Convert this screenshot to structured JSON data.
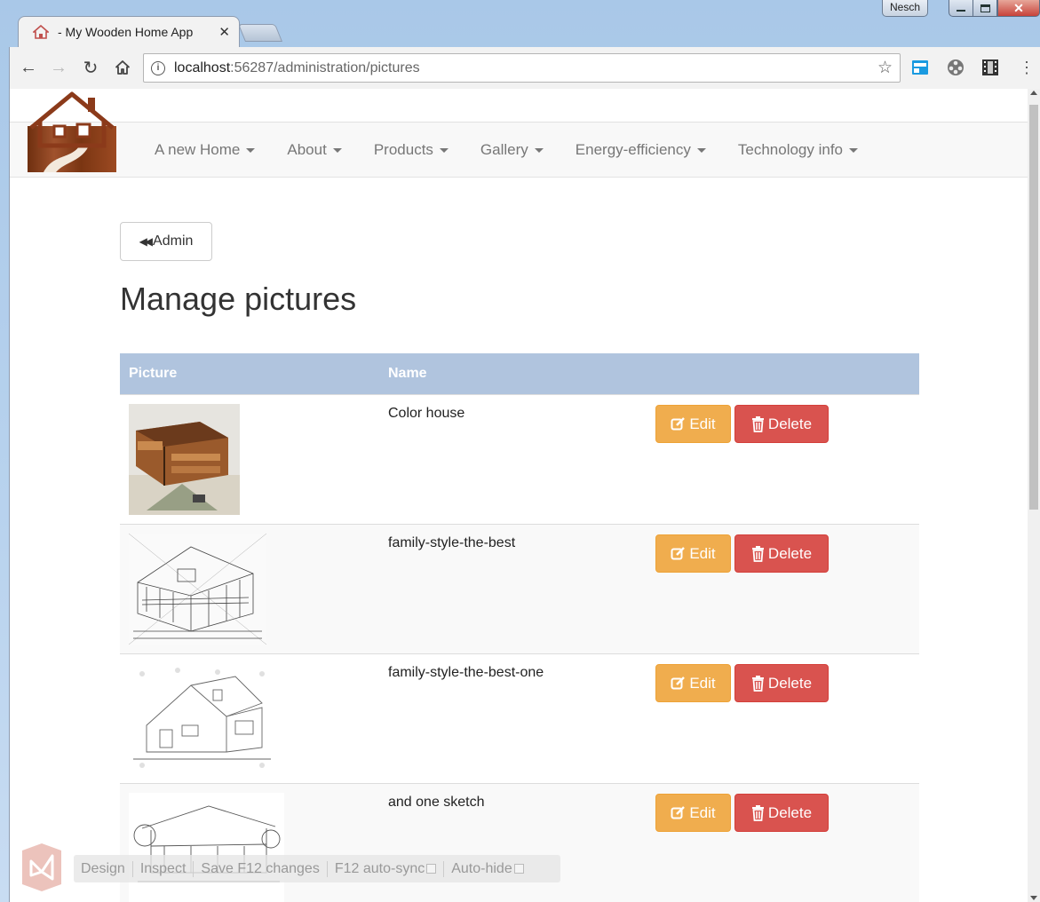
{
  "browser": {
    "tab_title": "- My Wooden Home App",
    "address_host": "localhost",
    "address_rest": ":56287/administration/pictures",
    "user_badge": "Nesch"
  },
  "navbar": {
    "items": [
      {
        "label": "A new Home"
      },
      {
        "label": "About"
      },
      {
        "label": "Products"
      },
      {
        "label": "Gallery"
      },
      {
        "label": "Energy-efficiency"
      },
      {
        "label": "Technology info"
      }
    ]
  },
  "page": {
    "back_button": "Admin",
    "title": "Manage pictures"
  },
  "table": {
    "headers": [
      "Picture",
      "Name"
    ],
    "rows": [
      {
        "name": "Color house"
      },
      {
        "name": "family-style-the-best"
      },
      {
        "name": "family-style-the-best-one"
      },
      {
        "name": "and one sketch"
      }
    ],
    "edit_label": "Edit",
    "delete_label": "Delete"
  },
  "vs_toolbar": {
    "design": "Design",
    "inspect": "Inspect",
    "save": "Save F12 changes",
    "autosync": "F12 auto-sync",
    "autohide": "Auto-hide"
  },
  "colors": {
    "table_header": "#b0c4de",
    "edit_button": "#f0ad4e",
    "delete_button": "#d9534f",
    "logo_wood": "#8b4513"
  },
  "icons": [
    "home-icon",
    "info-icon",
    "star-icon",
    "backward-icon",
    "edit-icon",
    "trash-icon",
    "visual-studio-icon"
  ]
}
